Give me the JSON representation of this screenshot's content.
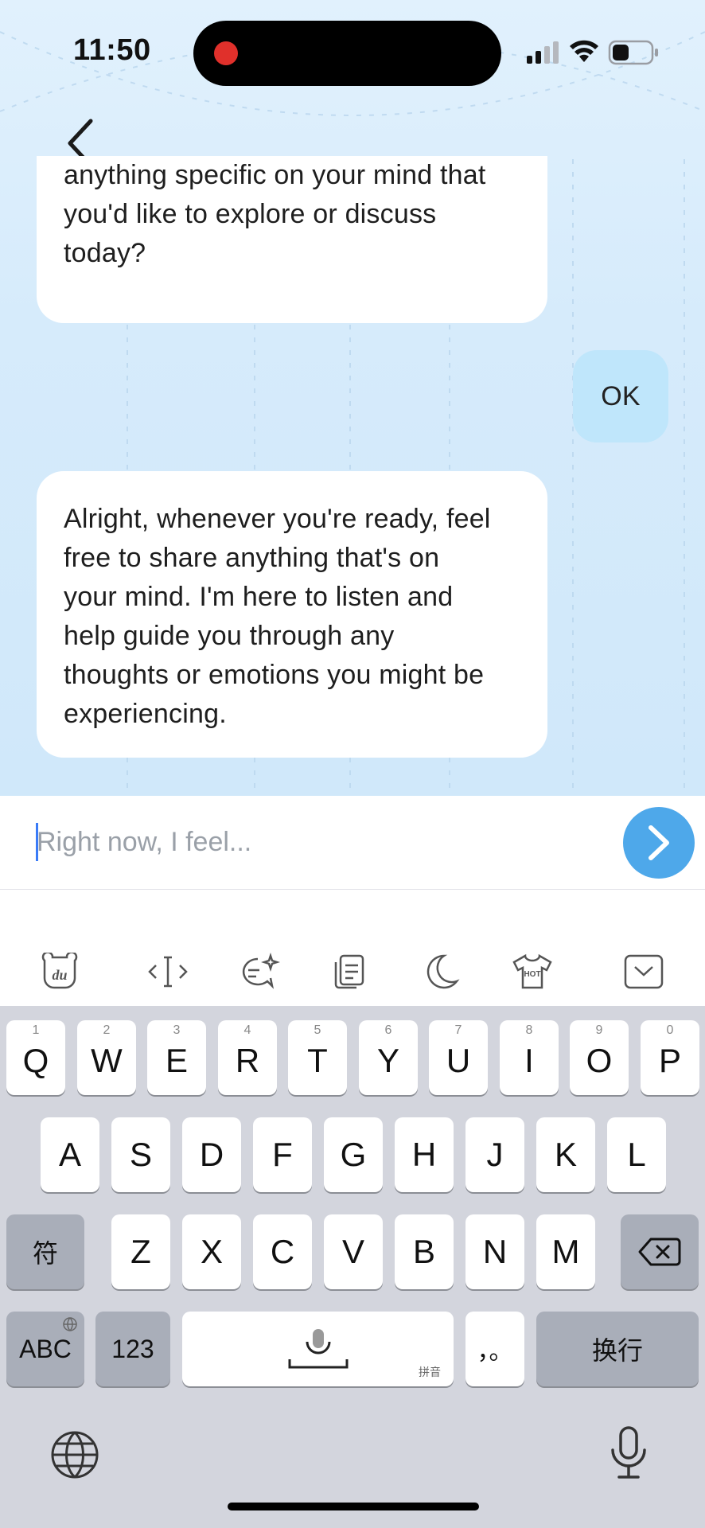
{
  "status_bar": {
    "time": "11:50"
  },
  "chat": {
    "messages": [
      {
        "role": "assistant",
        "lines": [
          "anything specific on your mind that",
          "you'd like to explore or discuss",
          "today?"
        ]
      },
      {
        "role": "user",
        "text": "OK"
      },
      {
        "role": "assistant",
        "lines": [
          "Alright, whenever you're ready, feel",
          "free to share anything that's on",
          "your mind. I'm here to listen and",
          "help guide you through any",
          "thoughts or emotions you might be",
          "experiencing."
        ]
      }
    ]
  },
  "input": {
    "placeholder": "Right now, I feel...",
    "value": ""
  },
  "keyboard": {
    "toolbar_icons": [
      "du-bear-icon",
      "cursor-icon",
      "magic-chat-icon",
      "clipboard-icon",
      "moon-icon",
      "hot-shirt-icon",
      "hide-keyboard-icon"
    ],
    "row1": [
      {
        "key": "Q",
        "hint": "1"
      },
      {
        "key": "W",
        "hint": "2"
      },
      {
        "key": "E",
        "hint": "3"
      },
      {
        "key": "R",
        "hint": "4"
      },
      {
        "key": "T",
        "hint": "5"
      },
      {
        "key": "Y",
        "hint": "6"
      },
      {
        "key": "U",
        "hint": "7"
      },
      {
        "key": "I",
        "hint": "8"
      },
      {
        "key": "O",
        "hint": "9"
      },
      {
        "key": "P",
        "hint": "0"
      }
    ],
    "row2": [
      "A",
      "S",
      "D",
      "F",
      "G",
      "H",
      "J",
      "K",
      "L"
    ],
    "row3": [
      "Z",
      "X",
      "C",
      "V",
      "B",
      "N",
      "M"
    ],
    "symbol_key": "符",
    "abc_key": "ABC",
    "num_key": "123",
    "space_sub": "拼音",
    "punct_key": "，。",
    "return_key": "换行"
  }
}
